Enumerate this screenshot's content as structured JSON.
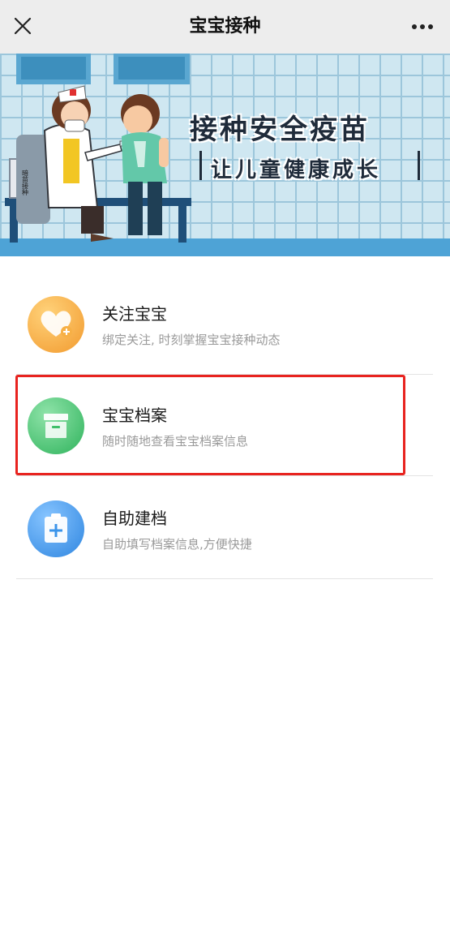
{
  "header": {
    "title": "宝宝接种",
    "close_icon": "close-icon",
    "more_icon": "more-icon"
  },
  "banner": {
    "title": "接种安全疫苗",
    "subtitle": "让儿童健康成长",
    "board_text": "暗苗接种"
  },
  "menu": {
    "items": [
      {
        "title": "关注宝宝",
        "desc": "绑定关注, 时刻掌握宝宝接种动态",
        "icon": "heart-plus-icon",
        "color": "#f5a431"
      },
      {
        "title": "宝宝档案",
        "desc": "随时随地查看宝宝档案信息",
        "icon": "archive-box-icon",
        "color": "#3fbf6a"
      },
      {
        "title": "自助建档",
        "desc": "自助填写档案信息,方便快捷",
        "icon": "clipboard-plus-icon",
        "color": "#3a94ea"
      }
    ]
  },
  "colors": {
    "highlight": "#e8231f",
    "topbar": "#ededed"
  }
}
